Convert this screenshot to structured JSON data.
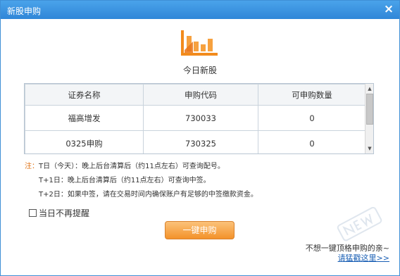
{
  "window": {
    "title": "新股申购",
    "close_glyph": "×"
  },
  "header": {
    "subtitle": "今日新股"
  },
  "table": {
    "headers": [
      "证券名称",
      "申购代码",
      "可申购数量"
    ],
    "rows": [
      [
        "福高增发",
        "730033",
        "0"
      ],
      [
        "0325申购",
        "730325",
        "0"
      ]
    ]
  },
  "notes": {
    "prefix": "注：",
    "t_day": "T日（今天）：晚上后台清算后（约11点左右）可查询配号。",
    "t1_day": "T+1日：晚上后台清算后（约11点左右）可查询中签。",
    "t2_day": "T+2日：如果中签，请在交易时间内确保账户有足够的中签缴款资金。"
  },
  "options": {
    "dont_remind_label": "当日不再提醒",
    "dont_remind_checked": false
  },
  "actions": {
    "one_click_label": "一键申购"
  },
  "promo": {
    "line": "不想一键顶格申购的亲~",
    "link_text": "请猛戳这里>>"
  },
  "colors": {
    "titlebar": "#3a8fdf",
    "accent_orange": "#f3922a",
    "link_blue": "#1a5fb4"
  }
}
